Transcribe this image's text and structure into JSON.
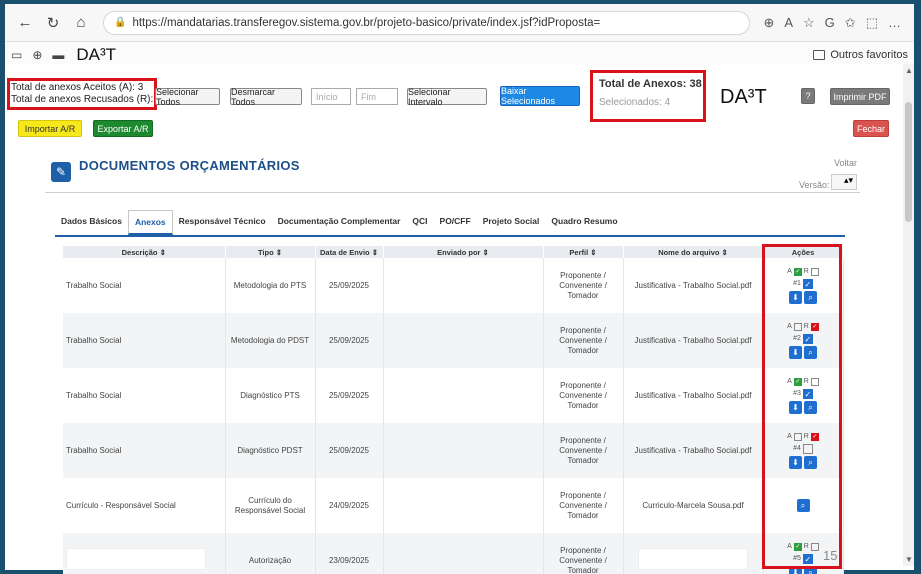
{
  "browser": {
    "url": "https://mandatarias.transferegov.sistema.gov.br/projeto-basico/private/index.jsf?idProposta=",
    "favorites_site": "DA³T",
    "outros_favoritos": "Outros favoritos"
  },
  "summary": {
    "aceitos": "Total de anexos Aceitos (A): 3",
    "recusados": "Total de anexos Recusados (R): 2",
    "total_anexos": "Total de Anexos: 38",
    "selecionados": "Selecionados: 4",
    "brand": "DA³T"
  },
  "toolbar": {
    "selecionar_todos": "Selecionar Todos",
    "desmarcar_todos": "Desmarcar Todos",
    "inicio_placeholder": "Início",
    "fim_placeholder": "Fim",
    "selecionar_intervalo": "Selecionar Intervalo",
    "baixar_selecionados": "Baixar Selecionados",
    "help": "?",
    "imprimir_pdf": "Imprimir PDF",
    "fechar": "Fechar",
    "importar": "Importar A/R",
    "exportar": "Exportar A/R"
  },
  "section": {
    "title": "DOCUMENTOS ORÇAMENTÁRIOS",
    "voltar": "Voltar",
    "versao_label": "Versão:"
  },
  "tabs": [
    "Dados Básicos",
    "Anexos",
    "Responsável Técnico",
    "Documentação Complementar",
    "QCI",
    "PO/CFF",
    "Projeto Social",
    "Quadro Resumo"
  ],
  "table": {
    "headers": [
      "Descrição ⇕",
      "Tipo ⇕",
      "Data de Envio ⇕",
      "Enviado por ⇕",
      "Perfil ⇕",
      "Nome do arquivo ⇕",
      "Ações"
    ],
    "rows": [
      {
        "descricao": "Trabalho Social",
        "tipo": "Metodologia do PTS",
        "data": "25/09/2025",
        "perfil": "Proponente / Convenente / Tomador",
        "arquivo": "Justificativa - Trabalho Social.pdf",
        "num": "#1",
        "status": "A"
      },
      {
        "descricao": "Trabalho Social",
        "tipo": "Metodologia do PDST",
        "data": "25/09/2025",
        "perfil": "Proponente / Convenente / Tomador",
        "arquivo": "Justificativa - Trabalho Social.pdf",
        "num": "#2",
        "status": "R"
      },
      {
        "descricao": "Trabalho Social",
        "tipo": "Diagnóstico PTS",
        "data": "25/09/2025",
        "perfil": "Proponente / Convenente / Tomador",
        "arquivo": "Justificativa - Trabalho Social.pdf",
        "num": "#3",
        "status": "A"
      },
      {
        "descricao": "Trabalho Social",
        "tipo": "Diagnóstico PDST",
        "data": "25/09/2025",
        "perfil": "Proponente / Convenente / Tomador",
        "arquivo": "Justificativa - Trabalho Social.pdf",
        "num": "#4",
        "status": "R"
      },
      {
        "descricao": "Currículo - Responsável Social",
        "tipo": "Currículo do Responsável Social",
        "data": "24/09/2025",
        "perfil": "Proponente / Convenente / Tomador",
        "arquivo": "Curriculo-Marcela Sousa.pdf",
        "num": "",
        "status": ""
      },
      {
        "descricao": "",
        "tipo": "Autorização",
        "data": "23/09/2025",
        "perfil": "Proponente / Convenente / Tomador",
        "arquivo": "",
        "num": "#5",
        "status": "A"
      }
    ]
  },
  "page_number": "15",
  "colors": {
    "highlight": "#d8121b",
    "primary": "#1e6fd0",
    "accent_green": "#2e9e3e"
  }
}
